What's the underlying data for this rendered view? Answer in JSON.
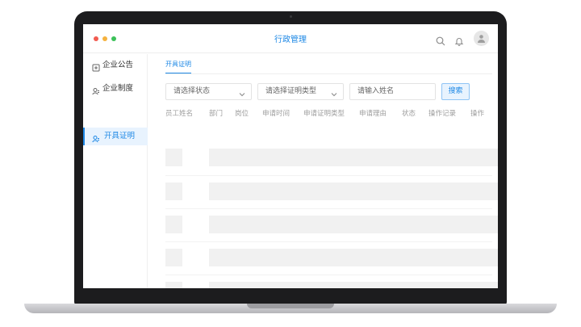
{
  "app": {
    "title": "行政管理"
  },
  "window": {
    "controls": [
      "close",
      "minimize",
      "maximize"
    ]
  },
  "header": {
    "icons": [
      "search-icon",
      "bell-icon",
      "user-avatar-icon"
    ]
  },
  "sidebar": {
    "items": [
      {
        "label": "企业公告",
        "icon": "announcement-icon",
        "active": false
      },
      {
        "label": "企业制度",
        "icon": "policy-icon",
        "active": false
      },
      {
        "label": "开具证明",
        "icon": "certificate-icon",
        "active": true
      }
    ]
  },
  "tabs": [
    {
      "label": "开具证明",
      "active": true
    }
  ],
  "filters": {
    "status_select": {
      "placeholder": "请选择状态"
    },
    "type_select": {
      "placeholder": "请选择证明类型"
    },
    "name_input": {
      "placeholder": "请输入姓名"
    },
    "search_button": "搜索"
  },
  "table": {
    "headers": [
      "员工姓名",
      "部门",
      "岗位",
      "申请时间",
      "申请证明类型",
      "申请理由",
      "状态",
      "操作记录",
      "操作"
    ],
    "state": "loading",
    "skeleton_rows": 5
  },
  "colors": {
    "accent": "#1e88e5",
    "active_bg": "#e8f3fe",
    "skeleton": "#f1f1f1"
  }
}
